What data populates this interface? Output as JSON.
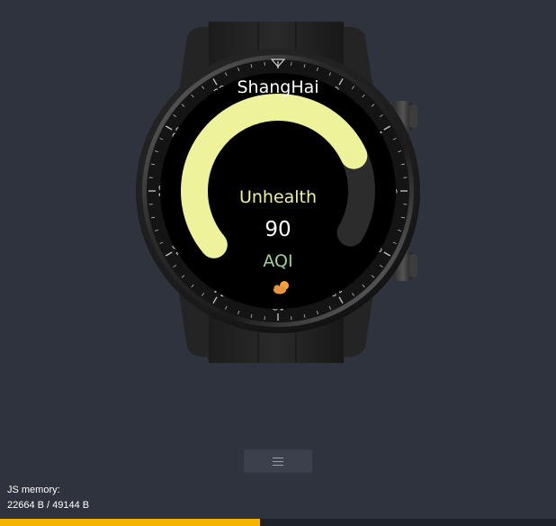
{
  "watch": {
    "city": "ShangHai",
    "status": "Unhealth",
    "value": "90",
    "unit": "AQI",
    "gauge_fraction": 0.78,
    "colors": {
      "gauge": "#eef29a",
      "gauge_track": "#2c2c2c",
      "status_text": "#eef29a",
      "unit_text": "#9fcf94",
      "value_text": "#ffffff",
      "city_text": "#ffffff"
    },
    "icon": "cloud-sun-icon",
    "bezel_numbers": [
      "2",
      "4",
      "6",
      "8",
      "10",
      "12",
      "14",
      "16",
      "18",
      "20",
      "22"
    ]
  },
  "menu": {
    "icon": "hamburger-icon"
  },
  "memory": {
    "label": "JS memory:",
    "value": "22664 B / 49144 B"
  },
  "progress": {
    "fraction": 0.468,
    "color": "#f5b400"
  }
}
